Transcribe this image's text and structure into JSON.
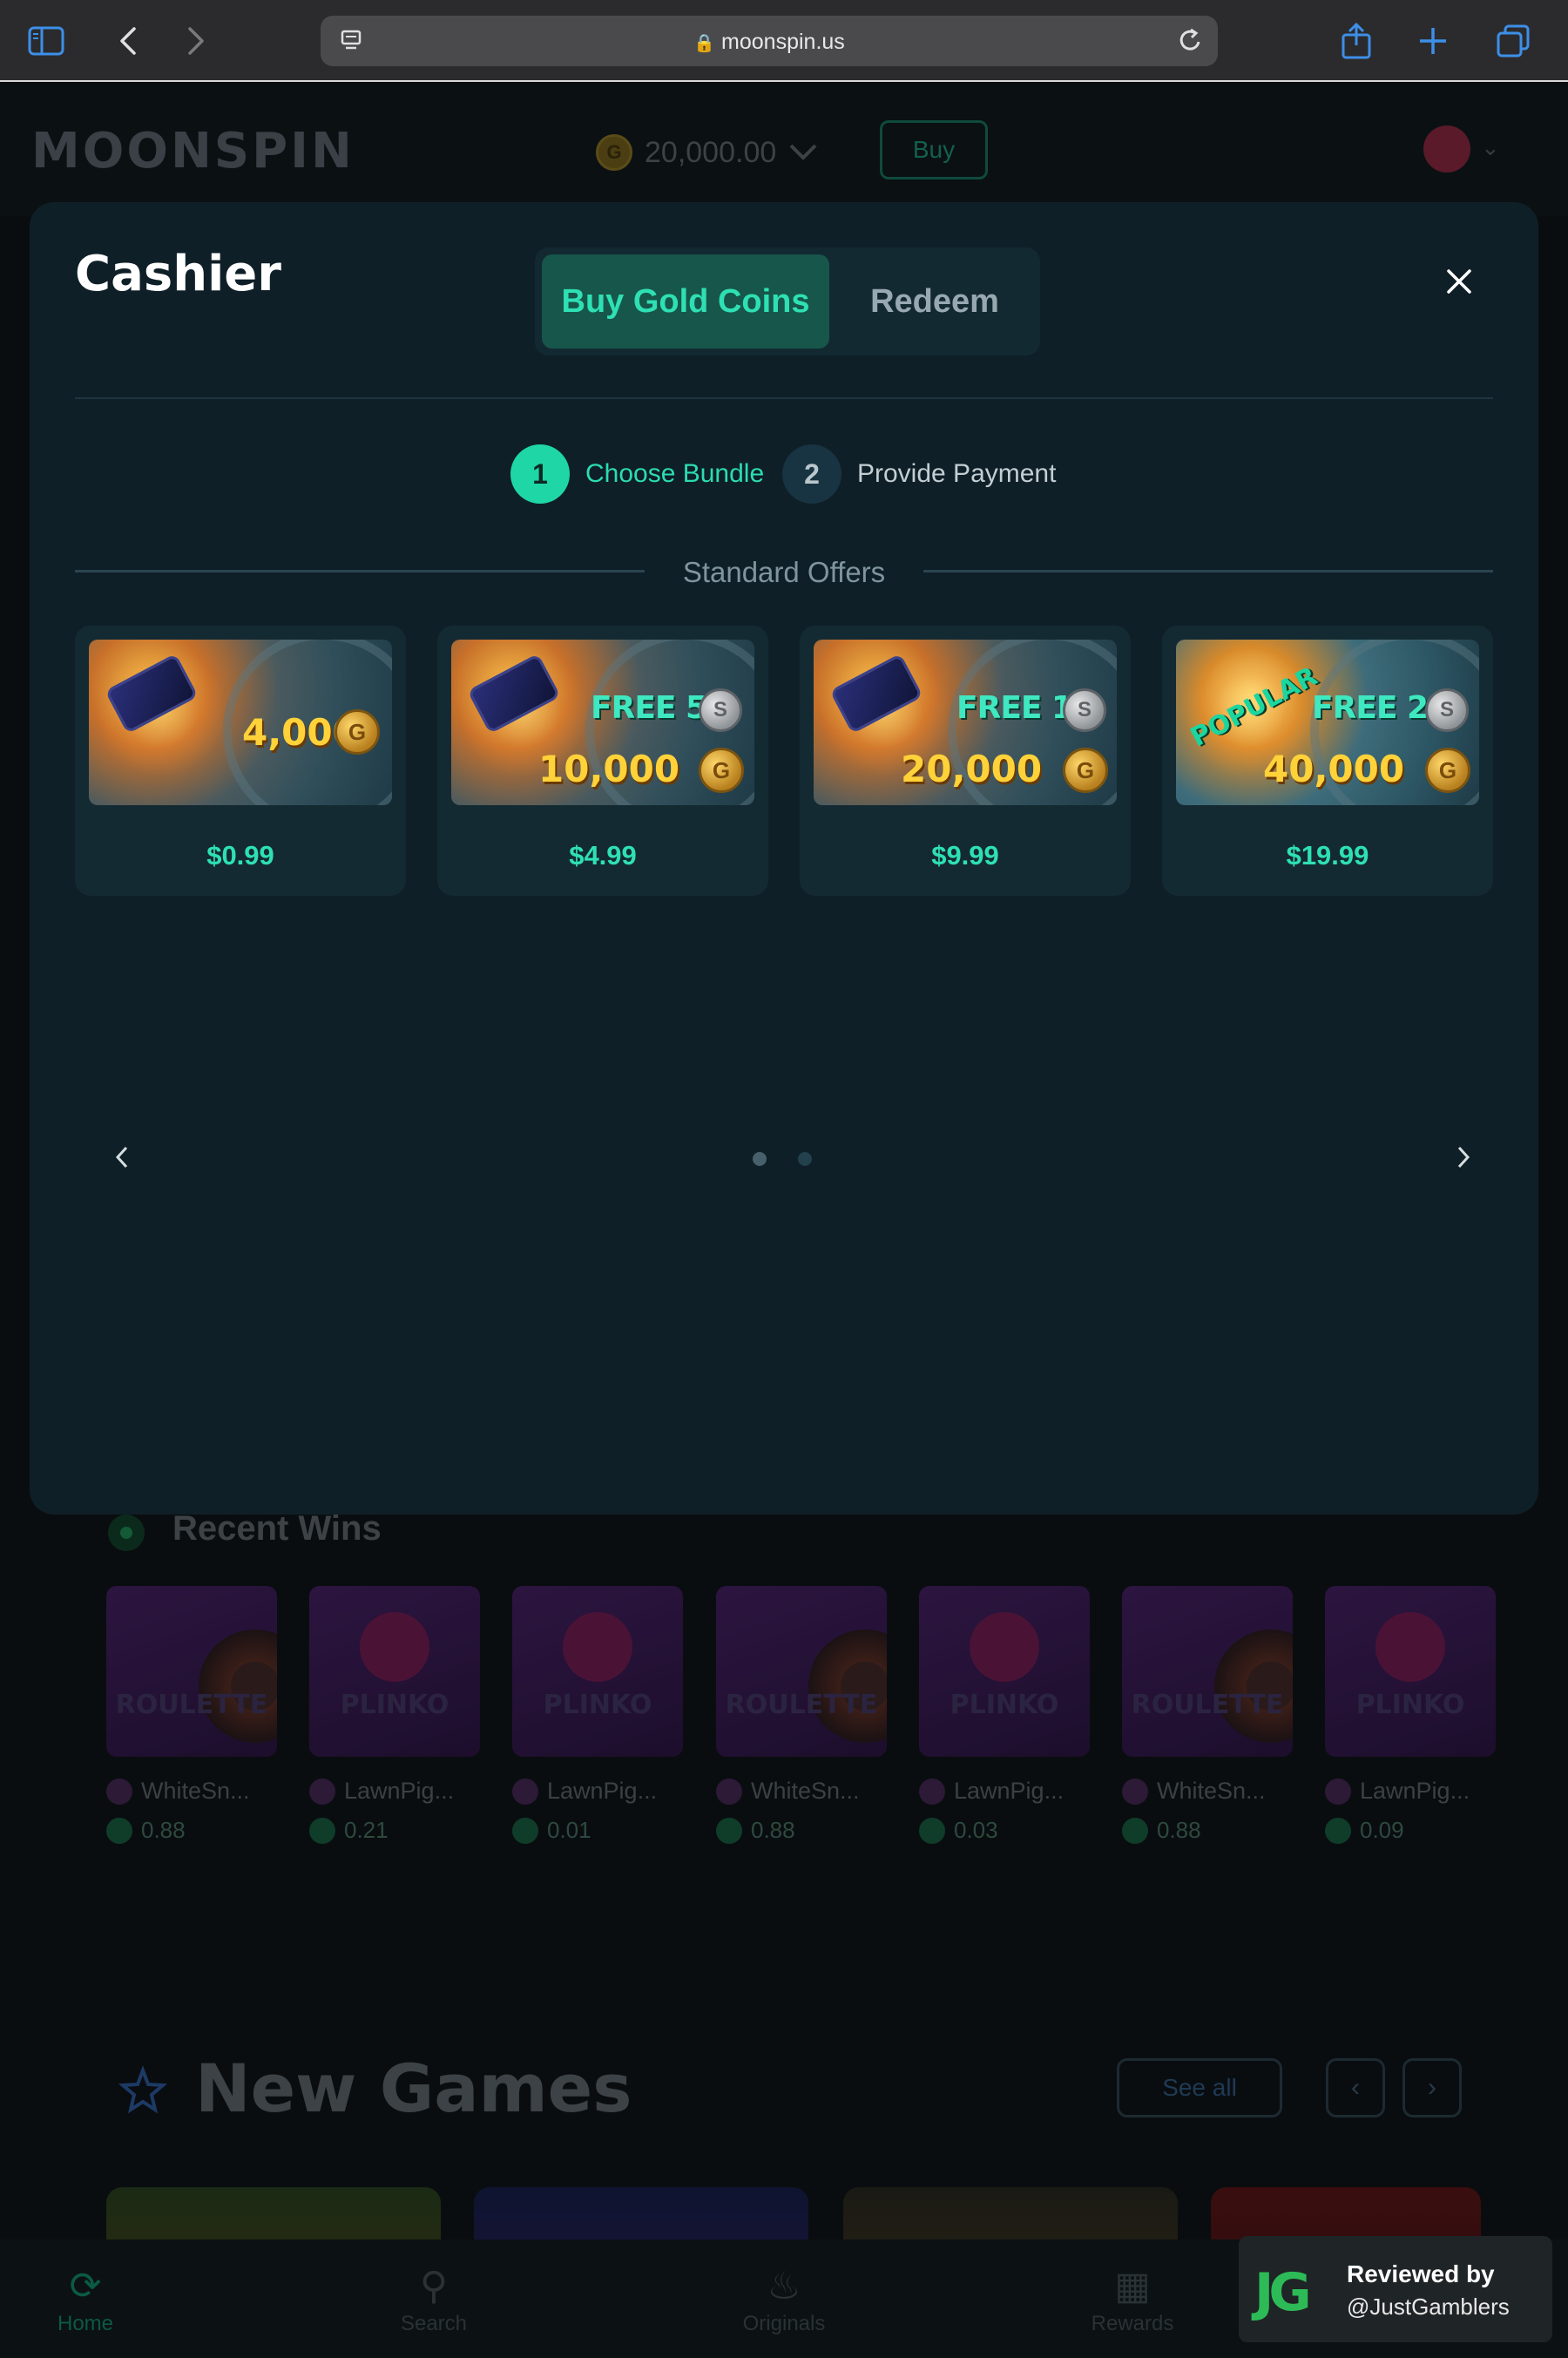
{
  "browser": {
    "url": "moonspin.us",
    "icons": [
      "sidebar-icon",
      "back-icon",
      "forward-icon",
      "reader-icon",
      "lock-icon",
      "reload-icon",
      "share-icon",
      "new-tab-icon",
      "tabs-icon"
    ]
  },
  "site": {
    "logo": "MOONSPIN",
    "balance": "20,000.00",
    "coin_symbol": "G",
    "buy_label": "Buy"
  },
  "modal": {
    "title": "Cashier",
    "tabs": [
      {
        "label": "Buy Gold Coins",
        "active": true
      },
      {
        "label": "Redeem",
        "active": false
      }
    ],
    "steps": [
      {
        "num": "1",
        "label": "Choose Bundle",
        "active": true
      },
      {
        "num": "2",
        "label": "Provide Payment",
        "active": false
      }
    ],
    "section_label": "Standard Offers",
    "offers": [
      {
        "coins": "4,000",
        "free": "",
        "price": "$0.99",
        "badge": ""
      },
      {
        "coins": "10,000",
        "free": "FREE 5",
        "price": "$4.99",
        "badge": ""
      },
      {
        "coins": "20,000",
        "free": "FREE 10",
        "price": "$9.99",
        "badge": ""
      },
      {
        "coins": "40,000",
        "free": "FREE 20",
        "price": "$19.99",
        "badge": "POPULAR"
      }
    ],
    "carousel": {
      "pages": 2,
      "current": 1
    }
  },
  "recent_wins": {
    "title": "Recent Wins",
    "items": [
      {
        "game": "ROULETTE",
        "user": "WhiteSn...",
        "amount": "0.88"
      },
      {
        "game": "PLINKO",
        "user": "LawnPig...",
        "amount": "0.21"
      },
      {
        "game": "PLINKO",
        "user": "LawnPig...",
        "amount": "0.01"
      },
      {
        "game": "ROULETTE",
        "user": "WhiteSn...",
        "amount": "0.88"
      },
      {
        "game": "PLINKO",
        "user": "LawnPig...",
        "amount": "0.03"
      },
      {
        "game": "ROULETTE",
        "user": "WhiteSn...",
        "amount": "0.88"
      },
      {
        "game": "PLINKO",
        "user": "LawnPig...",
        "amount": "0.09"
      }
    ]
  },
  "new_games": {
    "title": "New Games",
    "see_all": "See all"
  },
  "bottom_nav": [
    {
      "label": "Home",
      "active": true
    },
    {
      "label": "Search",
      "active": false
    },
    {
      "label": "Originals",
      "active": false
    },
    {
      "label": "Rewards",
      "active": false
    }
  ],
  "review": {
    "logo": "JG",
    "line1": "Reviewed by",
    "line2": "@JustGamblers"
  }
}
